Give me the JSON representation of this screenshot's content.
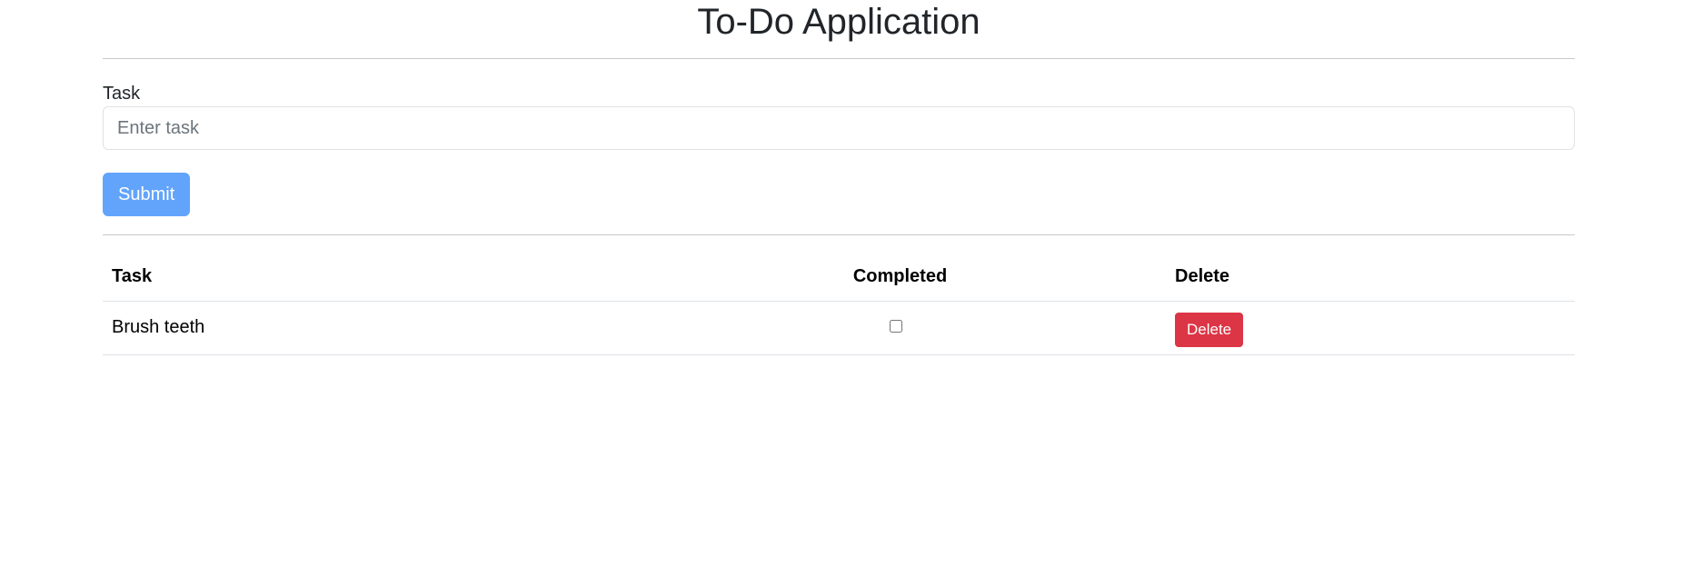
{
  "header": {
    "title": "To-Do Application"
  },
  "form": {
    "task_label": "Task",
    "task_input": {
      "placeholder": "Enter task",
      "value": ""
    },
    "submit_label": "Submit"
  },
  "table": {
    "headers": {
      "task": "Task",
      "completed": "Completed",
      "delete": "Delete"
    },
    "rows": [
      {
        "task": "Brush teeth",
        "completed": false,
        "delete_label": "Delete"
      }
    ]
  },
  "colors": {
    "submit_button": "#62a4fc",
    "delete_button": "#dc3545"
  }
}
